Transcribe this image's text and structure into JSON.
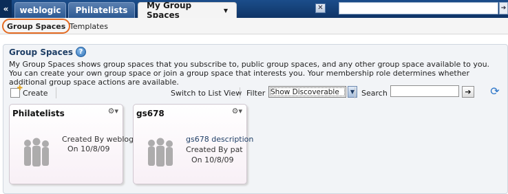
{
  "tabs": {
    "items": [
      {
        "label": "weblogic"
      },
      {
        "label": "Philatelists"
      },
      {
        "label": "My Group Spaces"
      }
    ],
    "close_label": "✕",
    "scroll_left": "«",
    "search_go": "➔"
  },
  "subnav": {
    "items": [
      {
        "label": "Group Spaces"
      },
      {
        "label": "Templates"
      }
    ]
  },
  "panel": {
    "title": "Group Spaces",
    "help_glyph": "?",
    "description": "My Group Spaces shows group spaces that you subscribe to, public group spaces, and any other group space available to you. You can create your own group space or join a group space that interests you. Your membership role determines whether additional group space actions are available."
  },
  "toolbar": {
    "create_label": "Create",
    "switch_label": "Switch to List View",
    "filter_label": "Filter",
    "filter_value": "Show Discoverable",
    "search_label": "Search",
    "search_value": "",
    "go_glyph": "➔"
  },
  "cards": [
    {
      "title": "Philatelists",
      "description": "",
      "created_by": "Created By weblogic",
      "created_on": "On 10/8/09"
    },
    {
      "title": "gs678",
      "description": "gs678 description",
      "created_by": "Created By pat",
      "created_on": "On 10/8/09"
    }
  ],
  "icons": {
    "gear": "gear-icon",
    "refresh": "refresh-icon",
    "help": "help-icon",
    "create": "create-icon"
  },
  "colors": {
    "tabbar": "#1b4d8a",
    "highlight": "#e46b22",
    "link_blue": "#1f3f66"
  }
}
